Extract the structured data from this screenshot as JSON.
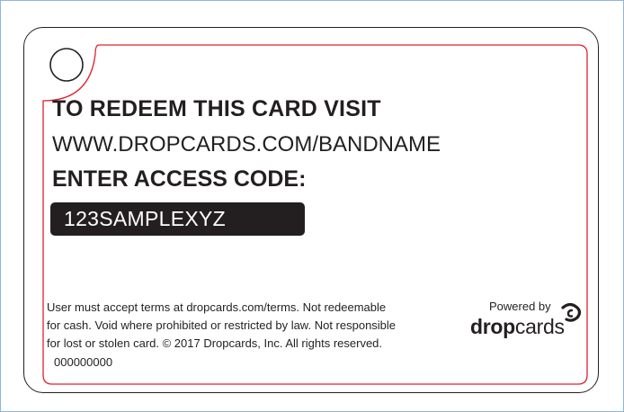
{
  "card": {
    "headline": "TO REDEEM THIS CARD VISIT",
    "url": "WWW.DROPCARDS.COM/BANDNAME",
    "access_label": "ENTER ACCESS CODE:",
    "access_code": "123SAMPLEXYZ",
    "terms_lines": [
      "User must accept terms at dropcards.com/terms. Not redeemable",
      "for cash.  Void where prohibited or restricted by law. Not responsible",
      "for lost or stolen card. © 2017 Dropcards, Inc.  All rights reserved."
    ],
    "serial": "000000000"
  },
  "brand": {
    "powered_by": "Powered by",
    "name_bold": "drop",
    "name_regular": "cards",
    "logo_icon": "dropcards-logo-icon"
  },
  "colors": {
    "ink": "#231f20",
    "safe_line": "#e0202e",
    "frame": "#8eb6dc"
  }
}
